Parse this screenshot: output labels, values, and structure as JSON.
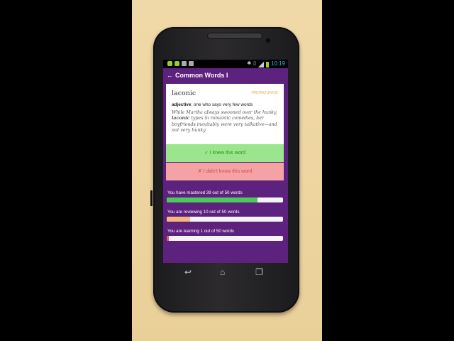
{
  "status_bar": {
    "time": "10:19",
    "left_icons": [
      "android-icon",
      "android-icon",
      "gmail-icon",
      "image-icon"
    ],
    "right_icons": [
      "bluetooth-icon",
      "vibrate-icon",
      "signal-icon",
      "battery-icon"
    ]
  },
  "action_bar": {
    "back_label": "←",
    "title": "Common Words I"
  },
  "word_card": {
    "word": "laconic",
    "pronounce_label": "PRONOUNCE",
    "part_of_speech": "adjective",
    "definition": ": one who says very few words",
    "example_before": "While Martha always swooned over the hunky, ",
    "example_word": "laconic",
    "example_after": " types in romantic comedies, her boyfriends inevitably were very talkative—and not very hunky."
  },
  "buttons": {
    "knew": "✓ I knew this word",
    "didnt_know": "✗ I didn't know this word"
  },
  "progress": [
    {
      "label": "You have mastered 39 out of 50 words",
      "fraction": 0.78,
      "color": "#4cc95a"
    },
    {
      "label": "You are reviewing 10 out of 50 words",
      "fraction": 0.2,
      "color": "#f5b87a"
    },
    {
      "label": "You are learning 1 out of 50 words",
      "fraction": 0.02,
      "color": "#e85a6a"
    }
  ],
  "nav": {
    "back_icon": "back-icon",
    "home_icon": "home-icon",
    "recents_icon": "recents-icon"
  },
  "colors": {
    "accent_purple": "#5d217e",
    "knew_bg": "#9be58c",
    "didnt_bg": "#f3a3a3",
    "pronounce": "#e8a640"
  }
}
